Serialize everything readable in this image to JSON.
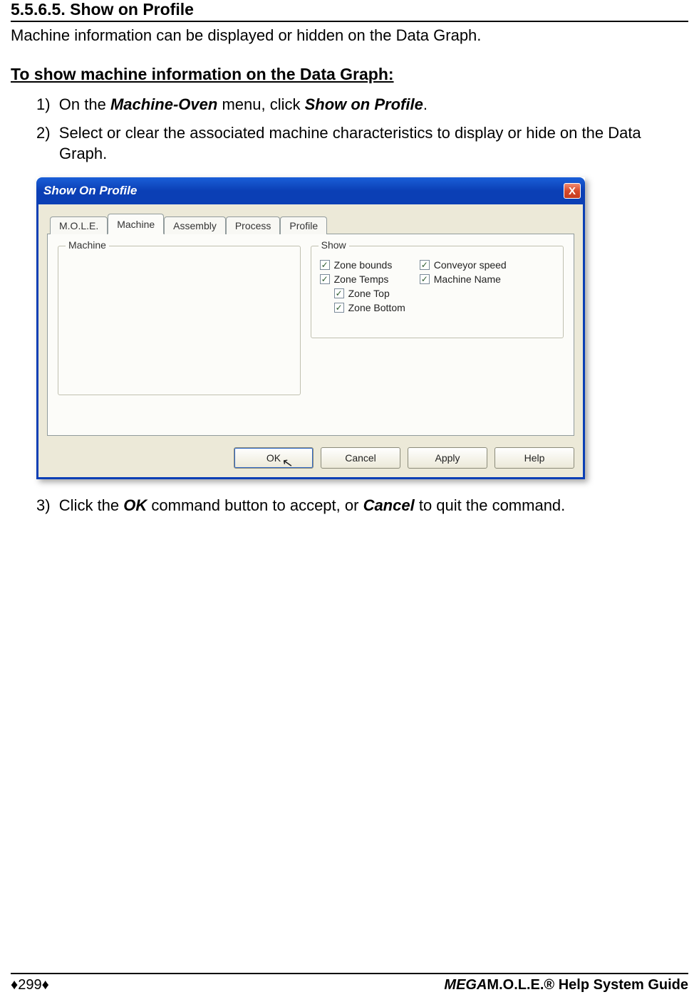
{
  "heading": "5.5.6.5. Show on Profile",
  "intro": "Machine information can be displayed or hidden on the Data Graph.",
  "sub_heading": "To show machine information on the Data Graph:",
  "steps": {
    "s1_num": "1)",
    "s1_a": "On the ",
    "s1_b": "Machine-Oven",
    "s1_c": " menu, click ",
    "s1_d": "Show on Profile",
    "s1_e": ".",
    "s2_num": "2)",
    "s2_a": "Select or clear the associated machine characteristics to display or hide on the Data Graph.",
    "s3_num": "3)",
    "s3_a": "Click the ",
    "s3_b": "OK",
    "s3_c": " command button to accept, or ",
    "s3_d": "Cancel",
    "s3_e": " to quit the command."
  },
  "dialog": {
    "title": "Show On Profile",
    "close_x": "X",
    "tabs": [
      "M.O.L.E.",
      "Machine",
      "Assembly",
      "Process",
      "Profile"
    ],
    "active_tab_index": 1,
    "group_machine": "Machine",
    "group_show": "Show",
    "checks": {
      "zone_bounds": "Zone bounds",
      "zone_temps": "Zone Temps",
      "zone_top": "Zone Top",
      "zone_bottom": "Zone Bottom",
      "conveyor_speed": "Conveyor speed",
      "machine_name": "Machine Name"
    },
    "checkmark": "✓",
    "buttons": {
      "ok": "OK",
      "cancel": "Cancel",
      "apply": "Apply",
      "help": "Help"
    }
  },
  "footer": {
    "left": "♦299♦",
    "right_ital": "MEGA",
    "right_rest": "M.O.L.E.® Help System Guide"
  }
}
